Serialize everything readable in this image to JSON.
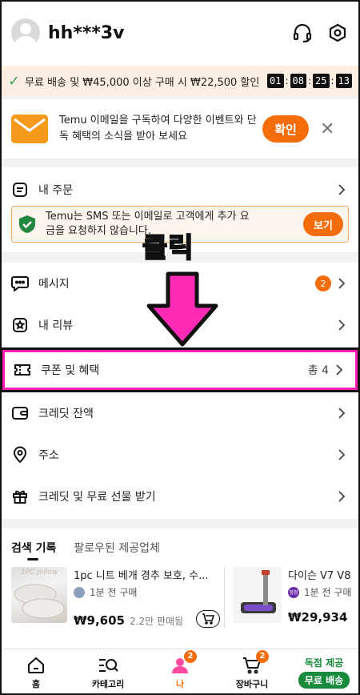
{
  "header": {
    "username": "hh***3v"
  },
  "promo": {
    "text": "무료 배송 및 ₩45,000 이상 구매 시 ₩22,500 할인",
    "timer": [
      "01",
      "08",
      "25",
      "13"
    ]
  },
  "email_card": {
    "text": "Temu 이메일을 구독하여 다양한 이벤트와 단독 혜택의 소식을 받아 보세요",
    "confirm_label": "확인"
  },
  "orders": {
    "label": "내 주문",
    "notice": "Temu는 SMS 또는 이메일로 고객에게 추가 요금을 요청하지 않습니다.",
    "notice_button": "보기"
  },
  "overlay": {
    "label": "클릭"
  },
  "menu": {
    "messages": {
      "label": "메시지",
      "badge": "2"
    },
    "reviews": {
      "label": "내 리뷰"
    },
    "coupons": {
      "label": "쿠폰 및 혜택",
      "count": "총 4"
    },
    "credit": {
      "label": "크레딧 잔액"
    },
    "address": {
      "label": "주소"
    },
    "gifts": {
      "label": "크레딧 및 무료 선물 받기"
    }
  },
  "tabs": [
    {
      "label": "검색 기록"
    },
    {
      "label": "팔로우된 제공업체"
    }
  ],
  "products": [
    {
      "name": "1pc 니트 베개 경추 보호, 수...",
      "time": "1분 전 구매",
      "price": "₩9,605",
      "sold": "2.2만 판매됨",
      "caption": "1PC pillow"
    },
    {
      "name": "다이슨 V7 V8",
      "time": "1분 전 구매",
      "price": "₩29,934",
      "seller_badge": "정정"
    }
  ],
  "bottom_nav": {
    "home": "홈",
    "category": "카테고리",
    "me": "나",
    "me_badge": "2",
    "cart": "장바구니",
    "cart_badge": "2",
    "exclusive": "독점 제공",
    "free_shipping": "무료 배송"
  },
  "colors": {
    "accent": "#f56d0b",
    "highlight": "#ff2bb5",
    "green": "#178a3c"
  }
}
